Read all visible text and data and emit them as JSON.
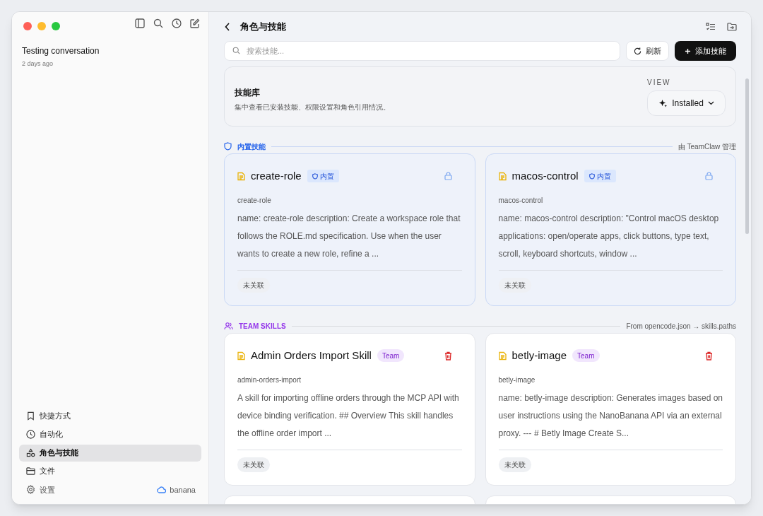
{
  "sidebar": {
    "conversations": [
      {
        "title": "Testing conversation",
        "time": "2 days ago"
      }
    ],
    "nav": [
      {
        "kind": "bookmark",
        "label": "快捷方式",
        "selected": false
      },
      {
        "kind": "clock",
        "label": "自动化",
        "selected": false
      },
      {
        "kind": "shapes",
        "label": "角色与技能",
        "selected": true
      },
      {
        "kind": "folder",
        "label": "文件",
        "selected": false
      }
    ],
    "settings": "设置",
    "account": "banana"
  },
  "header": {
    "title": "角色与技能"
  },
  "toolbar": {
    "search": {
      "placeholder": "搜索技能..."
    },
    "refresh": "刷新",
    "add": "添加技能"
  },
  "library": {
    "title": "技能库",
    "description": "集中查看已安装技能、权限设置和角色引用情况。",
    "view_label": "VIEW",
    "view_value": "Installed"
  },
  "sections": [
    {
      "kind": "builtin",
      "title": "内置技能",
      "note": "由 TeamClaw 管理",
      "cards": [
        {
          "name": "create-role",
          "badge": "内置",
          "slug": "create-role",
          "description": "name: create-role description: Create a workspace role that follows the ROLE.md specification. Use when the user wants to create a new role, refine a ...",
          "tag": "未关联"
        },
        {
          "name": "macos-control",
          "badge": "内置",
          "slug": "macos-control",
          "description": "name: macos-control description: \"Control macOS desktop applications: open/operate apps, click buttons, type text, scroll, keyboard shortcuts, window ...",
          "tag": "未关联"
        }
      ]
    },
    {
      "kind": "team",
      "title": "TEAM SKILLS",
      "note": "From opencode.json → skills.paths",
      "cards": [
        {
          "name": "Admin Orders Import Skill",
          "badge": "Team",
          "slug": "admin-orders-import",
          "description": "A skill for importing offline orders through the MCP API with device binding verification. ## Overview This skill handles the offline order import ...",
          "tag": "未关联"
        },
        {
          "name": "betly-image",
          "badge": "Team",
          "slug": "betly-image",
          "description": "name: betly-image description: Generates images based on user instructions using the NanoBanana API via an external proxy. --- # Betly Image Create S...",
          "tag": "未关联"
        }
      ]
    }
  ]
}
